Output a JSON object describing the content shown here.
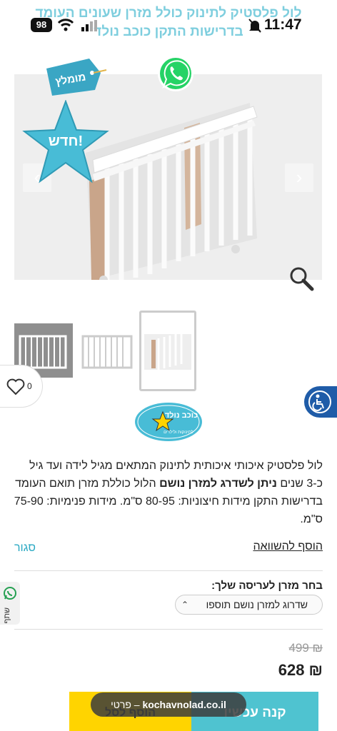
{
  "header": {
    "title_ghost": "לול פלסטיק לתינוק כולל מזרן שעונים העומד בדרישות התקן כוכב נולד"
  },
  "status_bar": {
    "battery": "98",
    "time": "11:47"
  },
  "gallery": {
    "prev": "‹",
    "next": "›"
  },
  "badges": {
    "tag_label": "מומלץ",
    "star_label": "חדש!"
  },
  "wishlist": {
    "count": "0"
  },
  "logo": {
    "text": "כוכב נולד",
    "subtext": "לתינוקות ולילדים"
  },
  "description": {
    "part1": "לול פלסטיק איכותי איכותית לתינוק המתאים מגיל לידה ועד גיל כ-3 שנים ",
    "bold": "ניתן לשדרג למזרן נושם",
    "part2": " הלול כוללת מזרן תואם העומד בדרישות התקן מידות חיצוניות: 80-95 ס\"מ. מידות פנימיות: 75-90 ס\"מ."
  },
  "compare": {
    "add_label": "הוסף להשוואה",
    "close_label": "סגור"
  },
  "option": {
    "label": "בחר מזרן לעריסה שלך:",
    "selected": "שדרוג למזרן נושם תוספו"
  },
  "share": {
    "label": "שתף"
  },
  "price": {
    "old": "₪ 499",
    "new": "₪ 628"
  },
  "actions": {
    "buy_label": "קנה עכשיו",
    "cart_label": "הוסף לסל"
  },
  "browser": {
    "url": "kochavnolad.co.il",
    "suffix": "– פרטי"
  }
}
